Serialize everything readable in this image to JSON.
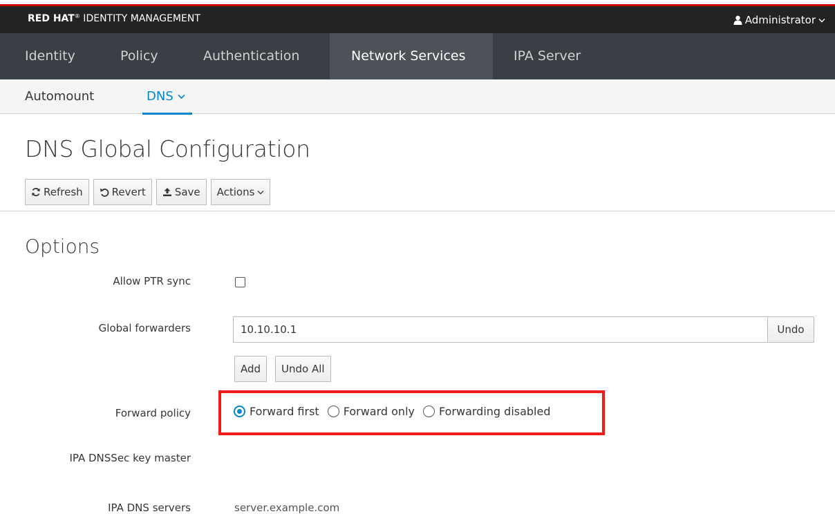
{
  "brand": {
    "bold": "RED HAT",
    "tm": "®",
    "rest": " IDENTITY MANAGEMENT"
  },
  "user": {
    "name": "Administrator"
  },
  "main_nav": [
    {
      "label": "Identity"
    },
    {
      "label": "Policy"
    },
    {
      "label": "Authentication"
    },
    {
      "label": "Network Services"
    },
    {
      "label": "IPA Server"
    }
  ],
  "sub_nav": [
    {
      "label": "Automount"
    },
    {
      "label": "DNS"
    }
  ],
  "page": {
    "title": "DNS Global Configuration"
  },
  "toolbar": {
    "refresh": "Refresh",
    "revert": "Revert",
    "save": "Save",
    "actions": "Actions"
  },
  "options": {
    "title": "Options",
    "allow_ptr_sync": {
      "label": "Allow PTR sync",
      "checked": false
    },
    "global_forwarders": {
      "label": "Global forwarders",
      "value": "10.10.10.1",
      "undo": "Undo",
      "add": "Add",
      "undo_all": "Undo All"
    },
    "forward_policy": {
      "label": "Forward policy",
      "options": [
        "Forward first",
        "Forward only",
        "Forwarding disabled"
      ],
      "selected": "Forward first"
    },
    "dnssec_key_master": {
      "label": "IPA DNSSec key master",
      "value": ""
    },
    "dns_servers": {
      "label": "IPA DNS servers",
      "value": "server.example.com"
    }
  },
  "colors": {
    "accent": "#0088ce",
    "highlight": "#ee1c1c",
    "brand_red": "#cc0000"
  }
}
